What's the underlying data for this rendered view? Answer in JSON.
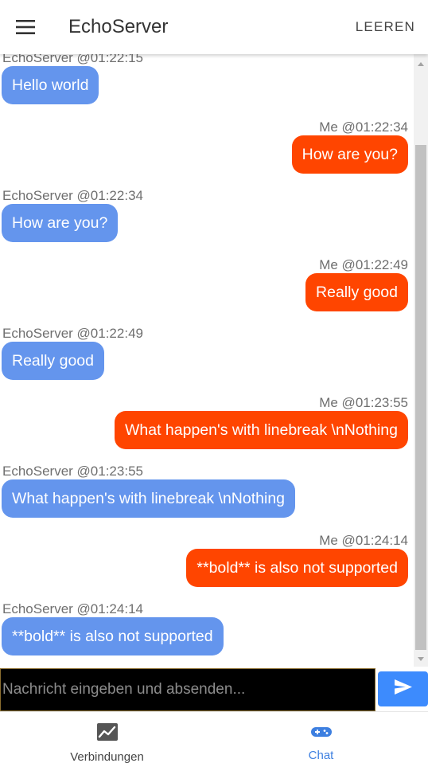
{
  "header": {
    "menu_icon": "hamburger-menu-icon",
    "title": "EchoServer",
    "clear_label": "LEEREN"
  },
  "messages": [
    {
      "direction": "in",
      "meta": "EchoServer @01:22:15",
      "text": "Hello world"
    },
    {
      "direction": "out",
      "meta": "Me @01:22:34",
      "text": "How are you?"
    },
    {
      "direction": "in",
      "meta": "EchoServer @01:22:34",
      "text": "How are you?"
    },
    {
      "direction": "out",
      "meta": "Me @01:22:49",
      "text": "Really good"
    },
    {
      "direction": "in",
      "meta": "EchoServer @01:22:49",
      "text": "Really good"
    },
    {
      "direction": "out",
      "meta": "Me @01:23:55",
      "text": "What happen's with linebreak \\nNothing"
    },
    {
      "direction": "in",
      "meta": "EchoServer @01:23:55",
      "text": "What happen's with linebreak \\nNothing"
    },
    {
      "direction": "out",
      "meta": "Me @01:24:14",
      "text": "**bold** is also not supported"
    },
    {
      "direction": "in",
      "meta": "EchoServer @01:24:14",
      "text": "**bold** is also not supported"
    }
  ],
  "composer": {
    "placeholder": "Nachricht eingeben und absenden...",
    "value": "",
    "send_icon": "send-icon"
  },
  "bottom_nav": {
    "items": [
      {
        "label": "Verbindungen",
        "icon": "chart-line-icon",
        "active": false
      },
      {
        "label": "Chat",
        "icon": "gamepad-icon",
        "active": true
      }
    ]
  },
  "colors": {
    "incoming_bubble": "#6495ED",
    "outgoing_bubble": "#FF4500",
    "send_button": "#3d8bfd",
    "active_nav": "#3d7fe0"
  }
}
